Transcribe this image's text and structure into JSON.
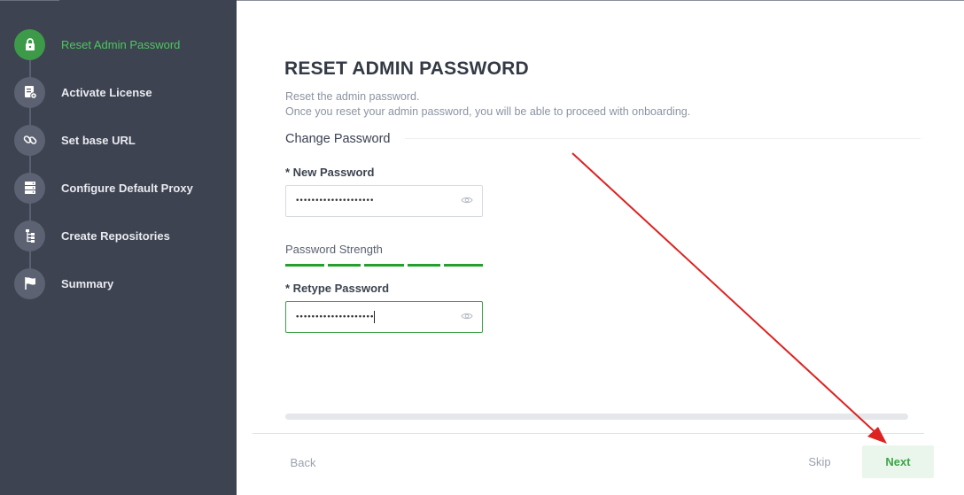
{
  "sidebar": {
    "steps": [
      {
        "label": "Reset Admin Password",
        "icon": "lock-icon",
        "active": true
      },
      {
        "label": "Activate License",
        "icon": "license-icon",
        "active": false
      },
      {
        "label": "Set base URL",
        "icon": "link-icon",
        "active": false
      },
      {
        "label": "Configure Default Proxy",
        "icon": "server-icon",
        "active": false
      },
      {
        "label": "Create Repositories",
        "icon": "repository-icon",
        "active": false
      },
      {
        "label": "Summary",
        "icon": "flag-icon",
        "active": false
      }
    ]
  },
  "page": {
    "title": "RESET ADMIN PASSWORD",
    "subtitle_line1": "Reset the admin password.",
    "subtitle_line2": "Once you reset your admin password, you will be able to proceed with onboarding.",
    "section_title": "Change Password"
  },
  "form": {
    "new_password_label": "* New Password",
    "new_password_value": "••••••••••••••••••••",
    "strength_label": "Password Strength",
    "strength_filled_segments": 5,
    "strength_total_segments": 5,
    "retype_password_label": "* Retype Password",
    "retype_password_value": "••••••••••••••••••••"
  },
  "footer": {
    "back_label": "Back",
    "skip_label": "Skip",
    "next_label": "Next"
  },
  "colors": {
    "sidebar_bg": "#3d4351",
    "accent_green": "#3ca548",
    "annotation_arrow": "#dd2222"
  }
}
